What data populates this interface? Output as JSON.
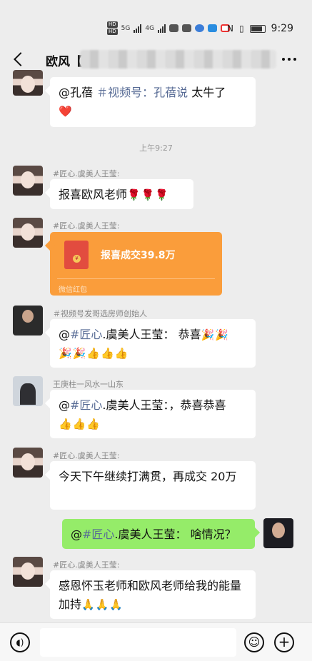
{
  "status_bar": {
    "hd1": "HD",
    "hd2": "HD",
    "net1": "5G",
    "net2": "4G",
    "time": "9:29"
  },
  "header": {
    "back_icon": "back-arrow-icon",
    "title": "欧风【",
    "more_icon": "more-dots-icon"
  },
  "messages": [
    {
      "text_mention": "@孔蓓 ",
      "text_link": "＃视频号：孔蓓说",
      "text_tail": "  太牛了",
      "emoji": "❤️"
    },
    {
      "time": "上午9:27"
    },
    {
      "sender": "#匠心.虞美人王莹:",
      "text": "报喜欧风老师",
      "emoji": "🌹🌹🌹"
    },
    {
      "sender": "#匠心.虞美人王莹:",
      "redpacket_title": "报喜成交39.8万",
      "redpacket_foot": "微信红包"
    },
    {
      "sender": "＃视频号发哥选房师创始人",
      "text_pre": "@",
      "text_link": "#匠心",
      "text_tail": ".虞美人王莹：  恭喜",
      "emoji1": "🎉🎉",
      "emoji2": "🎉🎉👍👍👍"
    },
    {
      "sender": "王庚柱一风水一山东",
      "text_pre": "@",
      "text_link": "#匠心",
      "text_tail": ".虞美人王莹：，恭喜恭喜",
      "emoji": "👍👍👍"
    },
    {
      "sender": "#匠心.虞美人王莹:",
      "text": "今天下午继续打满贯，再成交 20万"
    },
    {
      "text_pre": "@",
      "text_link": "#匠心",
      "text_tail": ".虞美人王莹：  啥情况？"
    },
    {
      "sender": "#匠心.虞美人王莹:",
      "text": "感恩怀玉老师和欧风老师给我的能量加持",
      "emoji": "🙏🙏🙏"
    }
  ],
  "input_bar": {
    "voice_icon": "voice-icon",
    "emoji_icon": "emoji-icon",
    "plus_icon": "plus-icon"
  }
}
